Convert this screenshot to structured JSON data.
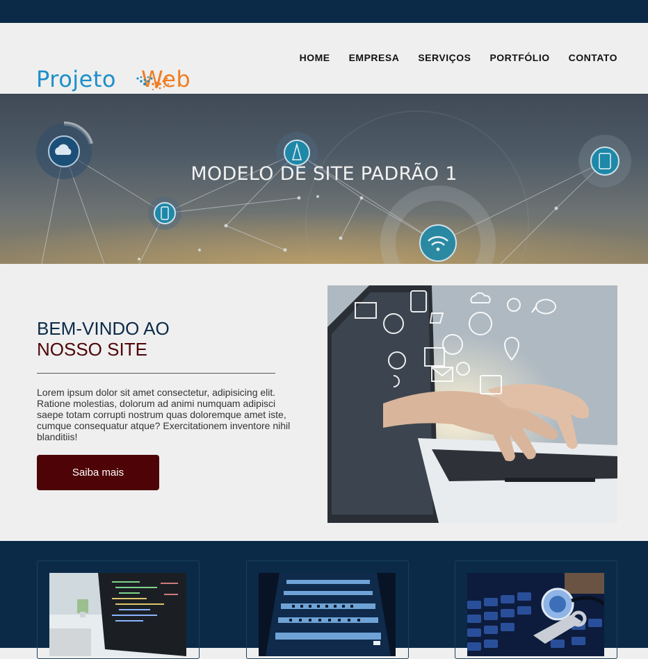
{
  "brand": {
    "logo_part1": "Projeto",
    "logo_part2": "Web",
    "colors": {
      "blue": "#1d8fc9",
      "orange": "#f07d22",
      "navy": "#0b2a48",
      "maroon": "#4e0407"
    }
  },
  "nav": {
    "items": [
      "HOME",
      "EMPRESA",
      "SERVIÇOS",
      "PORTFÓLIO",
      "CONTATO"
    ]
  },
  "hero": {
    "title": "MODELO DE SITE PADRÃO 1",
    "icons": [
      "cloud-icon",
      "pen-icon",
      "tablet-icon",
      "phone-icon",
      "wifi-icon"
    ]
  },
  "welcome": {
    "title_line1": "BEM-VINDO AO",
    "title_line2": "NOSSO SITE",
    "paragraph": "Lorem ipsum dolor sit amet consectetur, adipisicing elit. Ratione molestias, dolorum ad animi numquam adipisci saepe totam corrupti nostrum quas doloremque amet iste, cumque consequatur atque? Exercitationem inventore nihil blanditiis!",
    "button_label": "Saiba mais"
  },
  "cards": [
    {
      "name": "code-laptop"
    },
    {
      "name": "server-rack"
    },
    {
      "name": "keyboard-stethoscope"
    }
  ]
}
